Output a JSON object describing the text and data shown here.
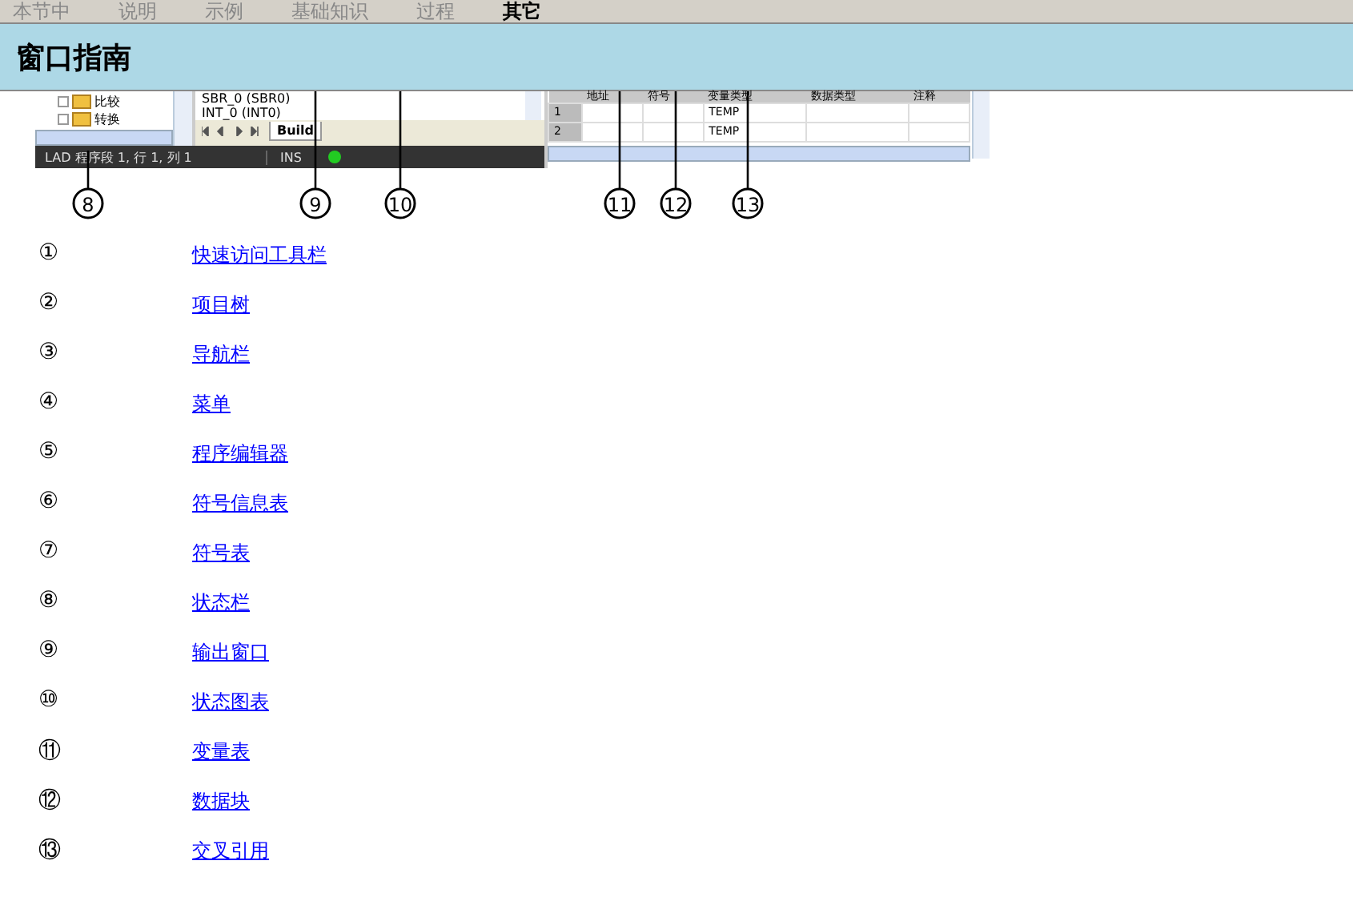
{
  "nav_tabs": [
    {
      "label": "本节中",
      "selected": false
    },
    {
      "label": "说明",
      "selected": false
    },
    {
      "label": "示例",
      "selected": false
    },
    {
      "label": "基础知识",
      "selected": false
    },
    {
      "label": "过程",
      "selected": false
    },
    {
      "label": "其它",
      "selected": true
    }
  ],
  "page_title": "窗口指南",
  "screenshot": {
    "tree_items": [
      "比较",
      "转换"
    ],
    "output_items": [
      "SBR_0 (SBR0)",
      "INT_0 (INT0)"
    ],
    "output_tab": "Build",
    "status_text": "LAD 程序段 1, 行 1, 列 1",
    "status_mode": "INS",
    "table": {
      "columns": [
        "地址",
        "符号",
        "变量类型",
        "数据类型",
        "注释"
      ],
      "rows": [
        {
          "number": "1",
          "cells": [
            "",
            "",
            "TEMP",
            "",
            ""
          ]
        },
        {
          "number": "2",
          "cells": [
            "",
            "",
            "TEMP",
            "",
            ""
          ]
        }
      ]
    },
    "callouts": [
      "8",
      "9",
      "10",
      "11",
      "12",
      "13"
    ]
  },
  "guide_items": [
    {
      "number": "①",
      "link": "快速访问工具栏"
    },
    {
      "number": "②",
      "link": "项目树"
    },
    {
      "number": "③",
      "link": "导航栏"
    },
    {
      "number": "④",
      "link": "菜单"
    },
    {
      "number": "⑤",
      "link": "程序编辑器"
    },
    {
      "number": "⑥",
      "link": "符号信息表"
    },
    {
      "number": "⑦",
      "link": "符号表"
    },
    {
      "number": "⑧",
      "link": "状态栏"
    },
    {
      "number": "⑨",
      "link": "输出窗口"
    },
    {
      "number": "⑩",
      "link": "状态图表"
    },
    {
      "number": "⑪",
      "link": "变量表"
    },
    {
      "number": "⑫",
      "link": "数据块"
    },
    {
      "number": "⑬",
      "link": "交叉引用"
    }
  ]
}
